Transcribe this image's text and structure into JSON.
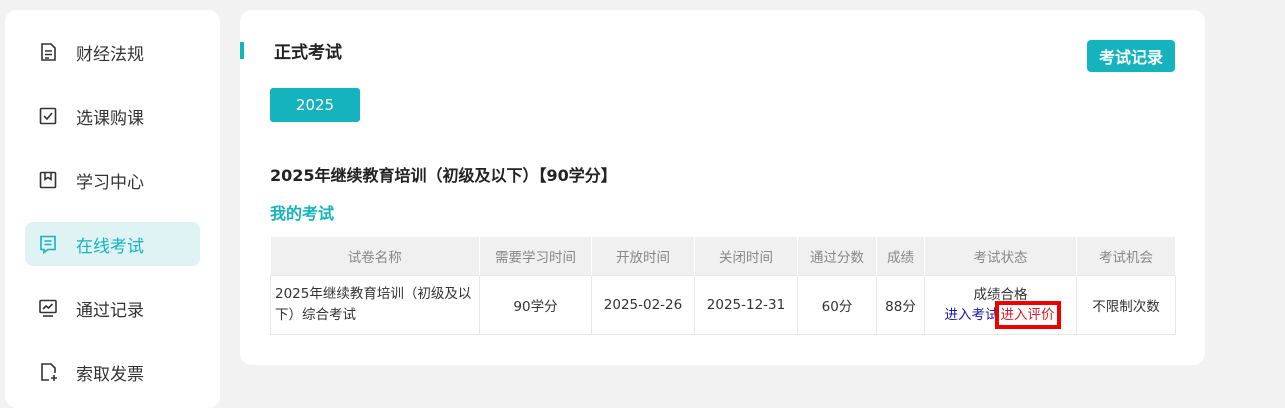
{
  "sidebar": {
    "items": [
      {
        "label": "财经法规",
        "icon": "document-icon"
      },
      {
        "label": "选课购课",
        "icon": "checklist-icon"
      },
      {
        "label": "学习中心",
        "icon": "bookmark-icon"
      },
      {
        "label": "在线考试",
        "icon": "exam-icon",
        "active": true
      },
      {
        "label": "通过记录",
        "icon": "chart-monitor-icon"
      },
      {
        "label": "索取发票",
        "icon": "invoice-icon"
      }
    ]
  },
  "main": {
    "title": "正式考试",
    "record_button": "考试记录",
    "year_tab": "2025",
    "course_title": "2025年继续教育培训（初级及以下）【90学分】",
    "section_label": "我的考试",
    "table": {
      "headers": [
        "试卷名称",
        "需要学习时间",
        "开放时间",
        "关闭时间",
        "通过分数",
        "成绩",
        "考试状态",
        "考试机会"
      ],
      "rows": [
        {
          "name": "2025年继续教育培训（初级及以下）综合考试",
          "study_time": "90学分",
          "open_time": "2025-02-26",
          "close_time": "2025-12-31",
          "pass_score": "60分",
          "score": "88分",
          "status": "成绩合格",
          "action_enter": "进入考试",
          "action_evaluate": "进入评价",
          "chances": "不限制次数"
        }
      ]
    }
  },
  "colors": {
    "accent": "#14b3bd",
    "highlight_box": "#ee0000",
    "link_blue": "#1a1aa6",
    "link_red": "#d4202a"
  }
}
